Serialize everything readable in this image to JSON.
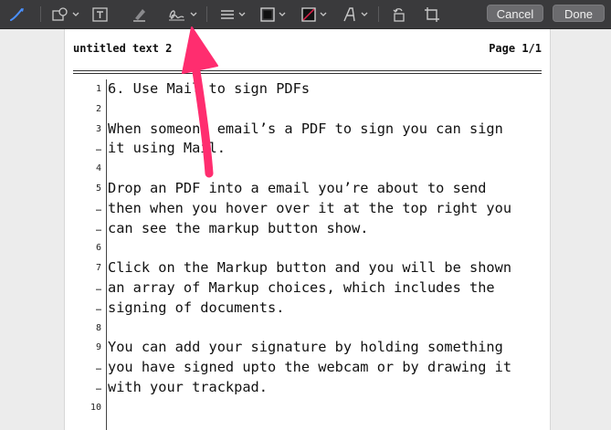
{
  "toolbar": {
    "icons": [
      "sketch-icon",
      "shapes-icon",
      "text-icon",
      "highlight-icon",
      "sign-icon",
      "line-style-icon",
      "border-color-icon",
      "fill-color-icon",
      "text-style-icon",
      "rotate-icon",
      "crop-icon"
    ],
    "cancel_label": "Cancel",
    "done_label": "Done"
  },
  "document": {
    "header_left": "untitled text 2",
    "header_right": "Page 1/1",
    "lines": [
      {
        "n": "1",
        "text": "6. Use Mail to sign PDFs"
      },
      {
        "n": "2",
        "text": ""
      },
      {
        "n": "3",
        "text": "When someone email’s a PDF to sign you can sign"
      },
      {
        "n": "…",
        "text": "it using Mail."
      },
      {
        "n": "4",
        "text": ""
      },
      {
        "n": "5",
        "text": "Drop an PDF into a email you’re about to send"
      },
      {
        "n": "…",
        "text": "then when you hover over it at the top right you"
      },
      {
        "n": "…",
        "text": "can see the markup button show."
      },
      {
        "n": "6",
        "text": ""
      },
      {
        "n": "7",
        "text": "Click on the Markup button and you will be shown"
      },
      {
        "n": "…",
        "text": "an array of Markup choices, which includes the"
      },
      {
        "n": "…",
        "text": "signing of documents."
      },
      {
        "n": "8",
        "text": ""
      },
      {
        "n": "9",
        "text": "You can add your signature by holding something"
      },
      {
        "n": "…",
        "text": "you have signed upto the webcam or by drawing it"
      },
      {
        "n": "…",
        "text": "with your trackpad."
      },
      {
        "n": "10",
        "text": ""
      }
    ]
  },
  "colors": {
    "toolbar_bg": "#3a3a3c",
    "arrow": "#ff2d6f",
    "accent_blue": "#3b82f6"
  }
}
